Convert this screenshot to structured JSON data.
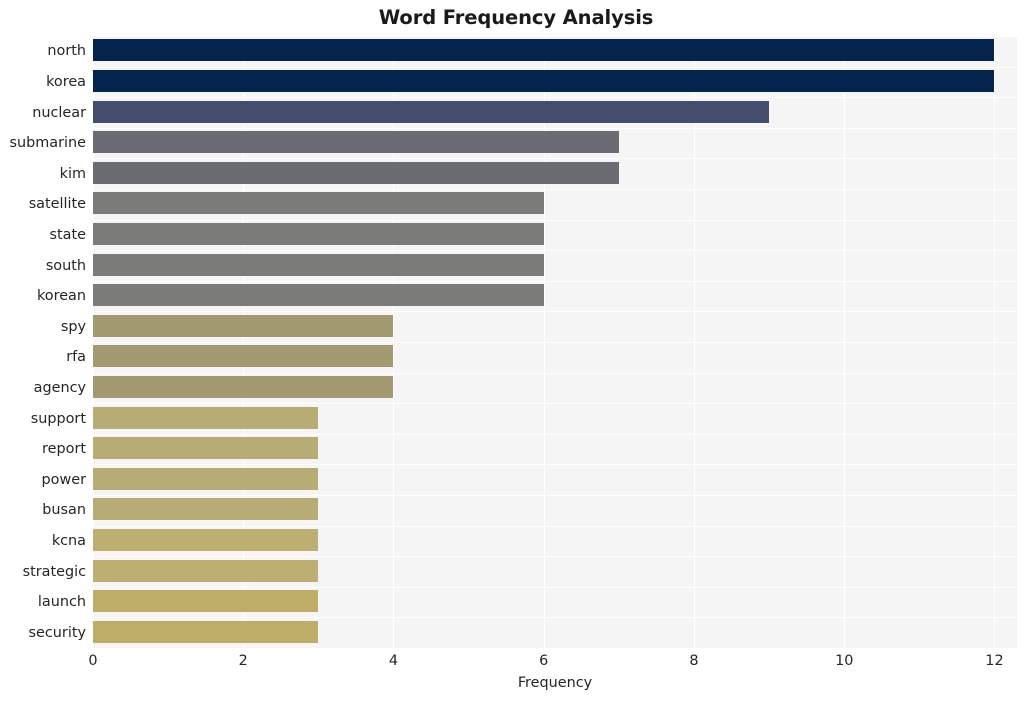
{
  "chart_data": {
    "type": "bar",
    "orientation": "horizontal",
    "title": "Word Frequency Analysis",
    "xlabel": "Frequency",
    "ylabel": "",
    "categories": [
      "north",
      "korea",
      "nuclear",
      "submarine",
      "kim",
      "satellite",
      "state",
      "south",
      "korean",
      "spy",
      "rfa",
      "agency",
      "support",
      "report",
      "power",
      "busan",
      "kcna",
      "strategic",
      "launch",
      "security"
    ],
    "values": [
      12,
      12,
      9,
      7,
      7,
      6,
      6,
      6,
      6,
      4,
      4,
      4,
      3,
      3,
      3,
      3,
      3,
      3,
      3,
      3
    ],
    "bar_colors": [
      "#04234d",
      "#04234d",
      "#444d6b",
      "#6b6c73",
      "#6b6c73",
      "#7b7b79",
      "#7b7b79",
      "#7b7b79",
      "#7b7b79",
      "#a39a71",
      "#a39a71",
      "#a39a71",
      "#b8ac75",
      "#b8ac75",
      "#b8ac75",
      "#b8ac75",
      "#bdae72",
      "#bdae72",
      "#bdad69",
      "#bdad69"
    ],
    "xlim": [
      0,
      12.3
    ],
    "xticks": [
      0,
      2,
      4,
      6,
      8,
      10,
      12
    ],
    "xtick_labels": [
      "0",
      "2",
      "4",
      "6",
      "8",
      "10",
      "12"
    ],
    "grid": true,
    "grid_color": "#ffffff",
    "plot_background": "#f5f5f6",
    "figure_background": "#ffffff",
    "legend": null
  }
}
